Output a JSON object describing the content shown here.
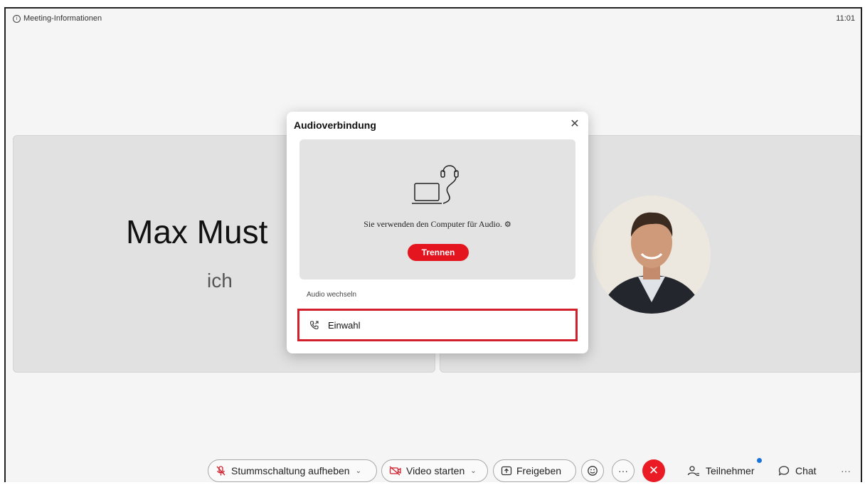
{
  "header": {
    "meeting_info_label": "Meeting-Informationen",
    "clock": "11:01"
  },
  "tiles": {
    "self_name": "Max Must",
    "self_sub": "ich"
  },
  "dialog": {
    "title": "Audioverbindung",
    "status_text": "Sie verwenden den Computer für Audio.",
    "disconnect_label": "Trennen",
    "switch_label": "Audio wechseln",
    "dialin_label": "Einwahl"
  },
  "toolbar": {
    "unmute_label": "Stummschaltung aufheben",
    "video_label": "Video starten",
    "share_label": "Freigeben",
    "participants_label": "Teilnehmer",
    "chat_label": "Chat",
    "more_label": "···",
    "reactions_more_label": "···"
  },
  "colors": {
    "accent_red": "#e4151f",
    "highlight_border": "#d11f2b",
    "notification_dot": "#1a73d9",
    "tile_bg": "#e1e1e1"
  },
  "icons": {
    "info": "info-icon",
    "close": "close-icon",
    "headset": "headset-laptop-icon",
    "gear": "gear-icon",
    "phone": "phone-dialin-icon",
    "mic_muted": "mic-muted-icon",
    "video_off": "video-off-icon",
    "share": "share-icon",
    "reactions": "emoji-icon",
    "end": "end-call-icon",
    "participants": "participants-icon",
    "chat": "chat-icon"
  }
}
